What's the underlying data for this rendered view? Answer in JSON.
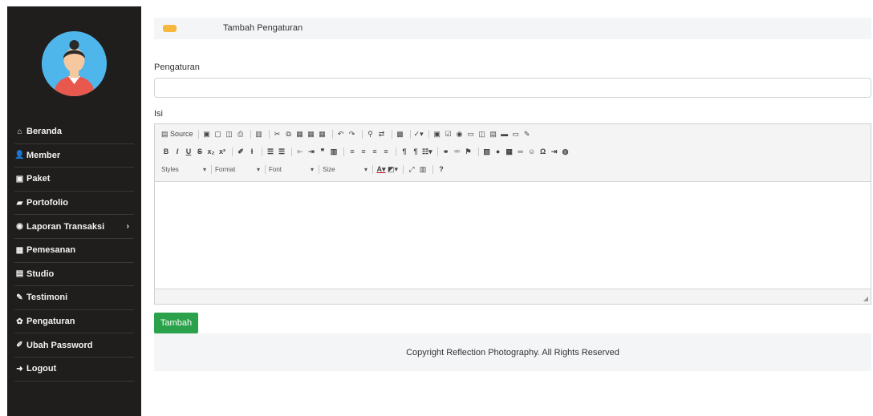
{
  "sidebar": {
    "items": [
      {
        "icon": "home-icon",
        "glyph": "⌂",
        "label": "Beranda"
      },
      {
        "icon": "user-icon",
        "glyph": "👤",
        "label": "Member"
      },
      {
        "icon": "image-icon",
        "glyph": "▣",
        "label": "Paket"
      },
      {
        "icon": "book-icon",
        "glyph": "▰",
        "label": "Portofolio"
      },
      {
        "icon": "globe-icon",
        "glyph": "◉",
        "label": "Laporan Transaksi",
        "caret": "›"
      },
      {
        "icon": "calendar-icon",
        "glyph": "▦",
        "label": "Pemesanan"
      },
      {
        "icon": "picture-icon",
        "glyph": "▤",
        "label": "Studio"
      },
      {
        "icon": "pencil-icon",
        "glyph": "✎",
        "label": "Testimoni"
      },
      {
        "icon": "gear-icon",
        "glyph": "✿",
        "label": "Pengaturan"
      },
      {
        "icon": "edit-icon",
        "glyph": "✐",
        "label": "Ubah Password"
      },
      {
        "icon": "logout-icon",
        "glyph": "➜",
        "label": "Logout"
      }
    ]
  },
  "panel": {
    "title": "Tambah Pengaturan",
    "accent": "#f5b83d"
  },
  "form": {
    "field1_label": "Pengaturan",
    "field1_value": "",
    "field2_label": "Isi",
    "submit_label": "Tambah",
    "submit_color": "#2aa14a"
  },
  "editor": {
    "source_label": "Source",
    "row2": [
      "B",
      "I",
      "U",
      "S",
      "x₂",
      "x²"
    ],
    "styles_label": "Styles",
    "format_label": "Format",
    "font_label": "Font",
    "size_label": "Size"
  },
  "footer": {
    "text": "Copyright Reflection Photography. All Rights Reserved"
  }
}
